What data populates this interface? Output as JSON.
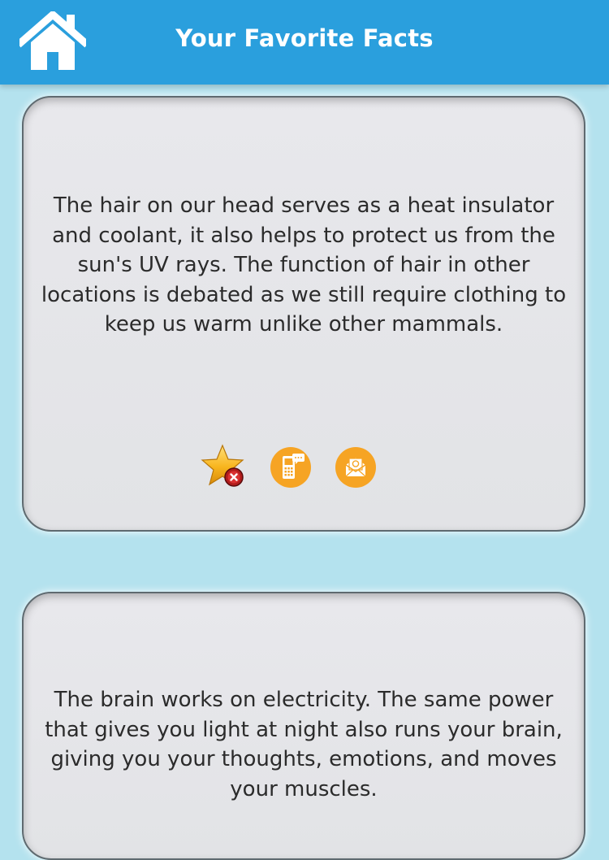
{
  "header": {
    "title": "Your Favorite Facts",
    "icon": "home-icon",
    "background_color": "#2a9fdd"
  },
  "facts": [
    {
      "text": "The hair on our head serves as a heat insulator and coolant, it also helps to protect us from the sun's UV rays. The function of hair in other locations is debated as we still require clothing to keep us warm unlike other mammals.",
      "actions": [
        "remove-favorite-star-icon",
        "sms-phone-icon",
        "email-envelope-icon"
      ]
    },
    {
      "text": "The brain works on electricity. The same power that gives you light at night also runs your brain, giving you your thoughts, emotions, and moves your muscles."
    }
  ],
  "colors": {
    "page_background": "#b4e2ee",
    "card_background": "#e6e6ea",
    "action_orange": "#f6a424",
    "remove_red": "#c62828"
  }
}
